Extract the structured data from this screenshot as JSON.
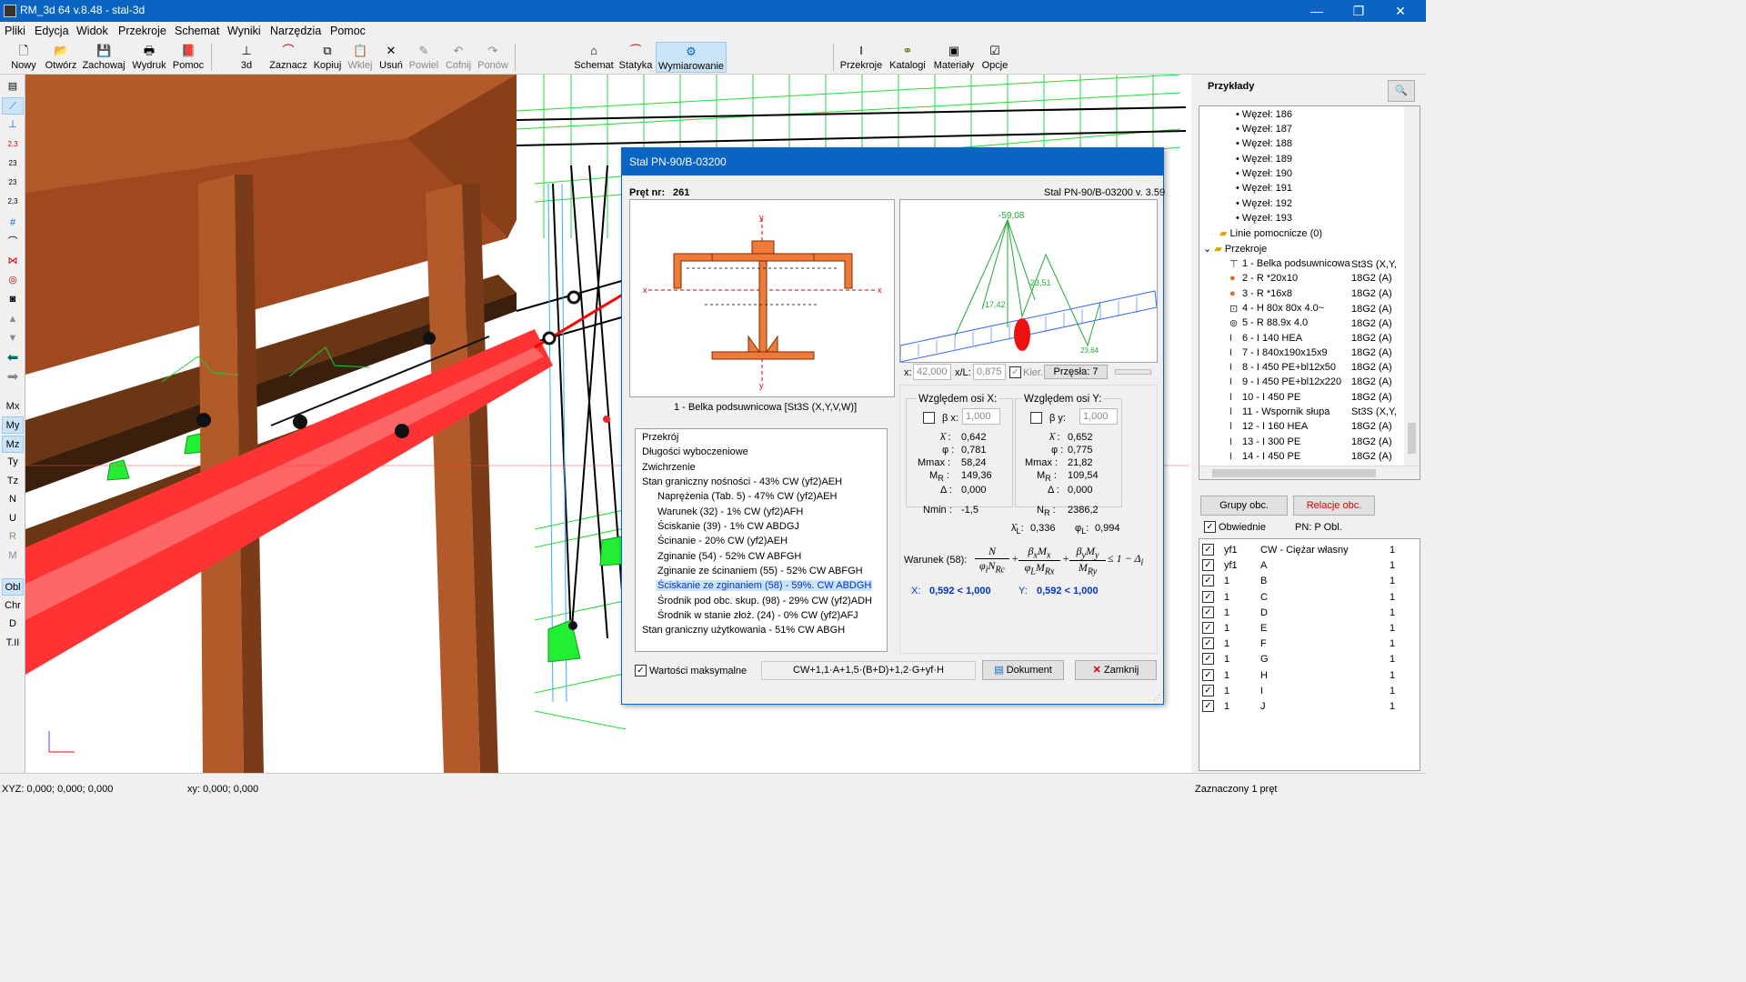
{
  "title": "RM_3d 64 v.8.48 - stal-3d",
  "window_controls": {
    "minimize": "—",
    "restore": "❐",
    "close": "✕"
  },
  "menu": [
    "Pliki",
    "Edycja",
    "Widok",
    "Przekroje",
    "Schemat",
    "Wyniki",
    "Narzędzia",
    "Pomoc"
  ],
  "toolbar": {
    "nowy": "Nowy",
    "otworz": "Otwórz",
    "zachowaj": "Zachowaj",
    "wydruk": "Wydruk",
    "pomoc": "Pomoc",
    "b3d": "3d",
    "zaznacz": "Zaznacz",
    "kopiuj": "Kopiuj",
    "wklej": "Wklej",
    "usun": "Usuń",
    "powiel": "Powiel",
    "cofnij": "Cofnij",
    "ponow": "Ponów",
    "schemat": "Schemat",
    "statyka": "Statyka",
    "wymiarowanie": "Wymiarowanie",
    "przekroje": "Przekroje",
    "katalogi": "Katalogi",
    "materialy": "Materiały",
    "opcje": "Opcje"
  },
  "left_toolbar": {
    "mx": "Mx",
    "my": "My",
    "mz": "Mz",
    "ty": "Ty",
    "tz": "Tz",
    "n": "N",
    "u": "U",
    "r": "R",
    "m": "M",
    "obl": "Obl",
    "chr": "Chr",
    "d": "D",
    "tii": "T.II",
    "l23a": "2,3",
    "l23b": "23",
    "l23c": "23",
    "l23d": "2,3"
  },
  "dialog": {
    "title": "Stal PN-90/B-03200",
    "pret_label": "Pręt nr:",
    "pret_nr": "261",
    "norma": "Stal PN-90/B-03200 v. 3.59",
    "section_caption": "1 - Belka podsuwnicowa  [St3S (X,Y,V,W)]",
    "diagram_values": {
      "top": "-59,08",
      "left": "-17,42",
      "mid": "-23,51",
      "right": "23,64"
    },
    "axis_labels": {
      "x_left": "x",
      "x_right": "x",
      "y_top": "y",
      "y_bottom": "y"
    },
    "pos": {
      "x_label": "x:",
      "x_value": "42,000",
      "xl_label": "x/L:",
      "xl_value": "0,875",
      "kier_label": "Kier.",
      "przesla": "Przęsła: 7"
    },
    "results_tree": [
      "Przekrój",
      "Długości wyboczeniowe",
      "Zwichrzenie",
      "Stan graniczny nośności - 43%   CW (yf2)AEH",
      "Naprężenia (Tab. 5) - 47%   CW (yf2)AEH",
      "Warunek (32) - 1%   CW (yf2)AFH",
      "Ściskanie (39) - 1%   CW ABDGJ",
      "Ścinanie - 20%   CW (yf2)AEH",
      "Zginanie (54) - 52%   CW ABFGH",
      "Zginanie ze ścinaniem (55) - 52%   CW ABFGH",
      "Ściskanie ze zginaniem (58) - 59%.   CW ABDGH",
      "Środnik pod obc. skup. (98) - 29%   CW (yf2)ADH",
      "Środnik w stanie złoż. (24) - 0%   CW (yf2)AFJ",
      "Stan graniczny użytkowania - 51%   CW ABGH"
    ],
    "osx": {
      "header": "Względem osi X:",
      "beta_label": "β x:",
      "beta_value": "1,000",
      "lambda": "0,642",
      "phi": "0,781",
      "mmax": "58,24",
      "mr": "149,36",
      "delta": "0,000"
    },
    "osy": {
      "header": "Względem osi Y:",
      "beta_label": "β y:",
      "beta_value": "1,000",
      "lambda": "0,652",
      "phi": "0,775",
      "mmax": "21,82",
      "mr": "109,54",
      "delta": "0,000"
    },
    "labels": {
      "lambda": "λ̄ :",
      "phi": "φ :",
      "mmax": "Mmax :",
      "mr": "M",
      "mr_sub": "R",
      "mr_colon": " :",
      "delta": "Δ :",
      "nmin": "Nmin :",
      "nr": "N",
      "nr_sub": "R",
      "nr_colon": " :",
      "lambdaL": "λ̄",
      "lambdaL_sub": "L",
      "lambdaL_colon": ":",
      "phiL": "φ",
      "phiL_sub": "L",
      "phiL_colon": ":",
      "xres": "X:",
      "yres": "Y:",
      "warunek": "Warunek (58):"
    },
    "nmin": "-1,5",
    "nr": "2386,2",
    "lambdaL": "0,336",
    "phiL": "0,994",
    "x_result": "0,592  <  1,000",
    "y_result": "0,592  <  1,000",
    "formula": {
      "n": "N",
      "phi_n": "φ",
      "phi_n_sub": "i",
      "n_rc": "N",
      "n_rc_sub": "Rc",
      "bx": "β",
      "bx_sub": "x",
      "mx": "M",
      "mx_sub": "x",
      "phil": "φ",
      "phil_sub": "L",
      "mrx": "M",
      "mrx_sub": "Rx",
      "by": "β",
      "by_sub": "y",
      "my": "M",
      "my_sub": "y",
      "mry": "M",
      "mry_sub": "Ry",
      "plus": "+",
      "le": "≤ 1 − Δ",
      "le_sub": "i"
    },
    "wartosci_label": "Wartości maksymalne",
    "combo": "CW+1,1·A+1,5·(B+D)+1,2·G+yf·H",
    "dokument": "Dokument",
    "zamknij": "Zamknij"
  },
  "right_panel": {
    "title": "Przykłady",
    "wezly": [
      "Węzeł: 186",
      "Węzeł: 187",
      "Węzeł: 188",
      "Węzeł: 189",
      "Węzeł: 190",
      "Węzeł: 191",
      "Węzeł: 192",
      "Węzeł: 193"
    ],
    "linie": "Linie pomocnicze (0)",
    "przekroje": "Przekroje",
    "sections": [
      {
        "name": "1 - Belka podsuwnicowa",
        "mat": "St3S (X,Y,"
      },
      {
        "name": "2 - R *20x10",
        "mat": "18G2 (A)"
      },
      {
        "name": "3 - R *16x8",
        "mat": "18G2 (A)"
      },
      {
        "name": "4 - H 80x 80x 4.0~",
        "mat": "18G2 (A)"
      },
      {
        "name": "5 - R 88.9x 4.0",
        "mat": "18G2 (A)"
      },
      {
        "name": "6 - I 140 HEA",
        "mat": "18G2 (A)"
      },
      {
        "name": "7 - I 840x190x15x9",
        "mat": "18G2 (A)"
      },
      {
        "name": "8 - I 450 PE+bl12x50",
        "mat": "18G2 (A)"
      },
      {
        "name": "9 - I 450 PE+bl12x220",
        "mat": "18G2 (A)"
      },
      {
        "name": "10 - I 450 PE",
        "mat": "18G2 (A)"
      },
      {
        "name": "11 - Wspornik słupa",
        "mat": "St3S (X,Y,"
      },
      {
        "name": "12 - I 160 HEA",
        "mat": "18G2 (A)"
      },
      {
        "name": "13 - I 300 PE",
        "mat": "18G2 (A)"
      },
      {
        "name": "14 - I 450 PE",
        "mat": "18G2 (A)"
      }
    ],
    "grupy": "Grupy obc.",
    "relacje": "Relacje obc.",
    "obwiednie": "Obwiednie",
    "pn": "PN:  P Obl.",
    "loads": [
      {
        "a": "yf1",
        "b": "CW - Ciężar własny",
        "c": "1"
      },
      {
        "a": "yf1",
        "b": "A",
        "c": "1"
      },
      {
        "a": "1",
        "b": "B",
        "c": "1"
      },
      {
        "a": "1",
        "b": "C",
        "c": "1"
      },
      {
        "a": "1",
        "b": "D",
        "c": "1"
      },
      {
        "a": "1",
        "b": "E",
        "c": "1"
      },
      {
        "a": "1",
        "b": "F",
        "c": "1"
      },
      {
        "a": "1",
        "b": "G",
        "c": "1"
      },
      {
        "a": "1",
        "b": "H",
        "c": "1"
      },
      {
        "a": "1",
        "b": "I",
        "c": "1"
      },
      {
        "a": "1",
        "b": "J",
        "c": "1"
      }
    ]
  },
  "status": {
    "xyz": "XYZ: 0,000; 0,000; 0,000",
    "xy": "xy: 0,000; 0,000",
    "selected": "Zaznaczony 1 pręt"
  }
}
